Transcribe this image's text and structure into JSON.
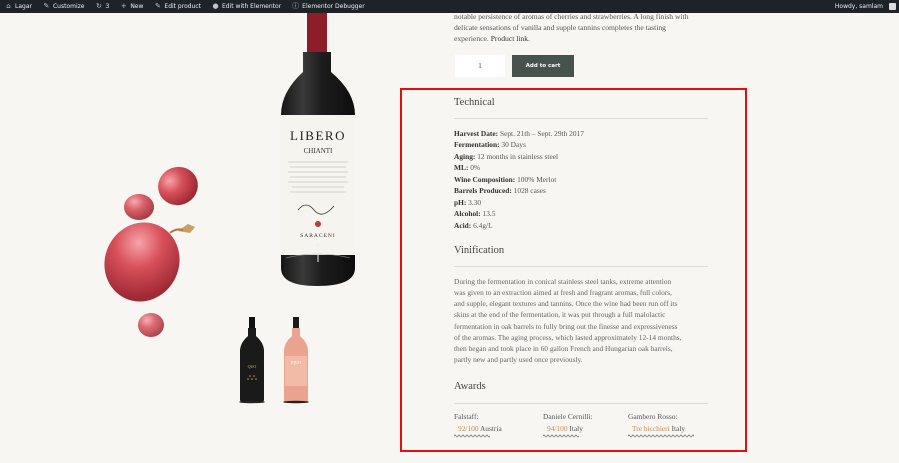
{
  "admin_bar": {
    "site_name": "Lagar",
    "customize": "Customize",
    "updates_count": "3",
    "new": "New",
    "edit_product": "Edit product",
    "edit_elementor": "Edit with Elementor",
    "elementor_debugger": "Elementor Debugger",
    "howdy": "Howdy, samlam"
  },
  "product": {
    "description_line1": "notable persistence of aromas of cherries and strawberries. A long finish with",
    "description_line2": "delicate sensations of vanilla and supple tannins completes the tasting",
    "description_line3": "experience.",
    "product_link": "Product link",
    "quantity": "1",
    "add_to_cart": "Add to cart",
    "bottle_brand": "LIBERO",
    "bottle_sub": "CHIANTI",
    "bottle_maker": "SARACENI"
  },
  "technical": {
    "title": "Technical",
    "rows": [
      {
        "label": "Harvest Date:",
        "value": "Sept. 21th – Sept. 29th 2017"
      },
      {
        "label": "Fermentation:",
        "value": "30 Days"
      },
      {
        "label": "Aging:",
        "value": "12 months in stainless steel"
      },
      {
        "label": "ML:",
        "value": "0%"
      },
      {
        "label": "Wine Composition:",
        "value": "100% Merlot"
      },
      {
        "label": "Barrels Produced:",
        "value": "1028 cases"
      },
      {
        "label": "pH:",
        "value": "3.30"
      },
      {
        "label": "Alcohol:",
        "value": "13.5"
      },
      {
        "label": "Acid:",
        "value": "6.4g/L"
      }
    ]
  },
  "vinification": {
    "title": "Vinification",
    "lines": [
      "During the fermentation in conical stainless steel tanks, extreme attention",
      "was given to an extraction aimed at fresh and fragrant aromas, full colors,",
      "and supple, elegant textures and tannins. Once the wine had been run off its",
      "skins at the end of the fermentation, it was put through a full malolactic",
      "fermentation in oak barrels to fully bring out the finesse and expressiveness",
      "of the aromas. The aging process, which lasted approximately 12-14 months,",
      "then began and took place in 60 gallon French and Hungarian oak barrels,",
      "partly new and partly used once previously."
    ]
  },
  "awards": {
    "title": "Awards",
    "items": [
      {
        "source": "Falstaff:",
        "score": "92/100",
        "country": "Austria"
      },
      {
        "source": "Daniele Cernilli:",
        "score": "94/100",
        "country": "Italy"
      },
      {
        "source": "Gambero Rosso:",
        "score": "Tre bicchieri",
        "country": "Italy"
      }
    ]
  },
  "colors": {
    "admin_bar_bg": "#1d2327",
    "button_bg": "#46524c",
    "highlight_border": "#e01010",
    "score_accent": "#c88a55",
    "page_bg": "#f7f6f3"
  }
}
